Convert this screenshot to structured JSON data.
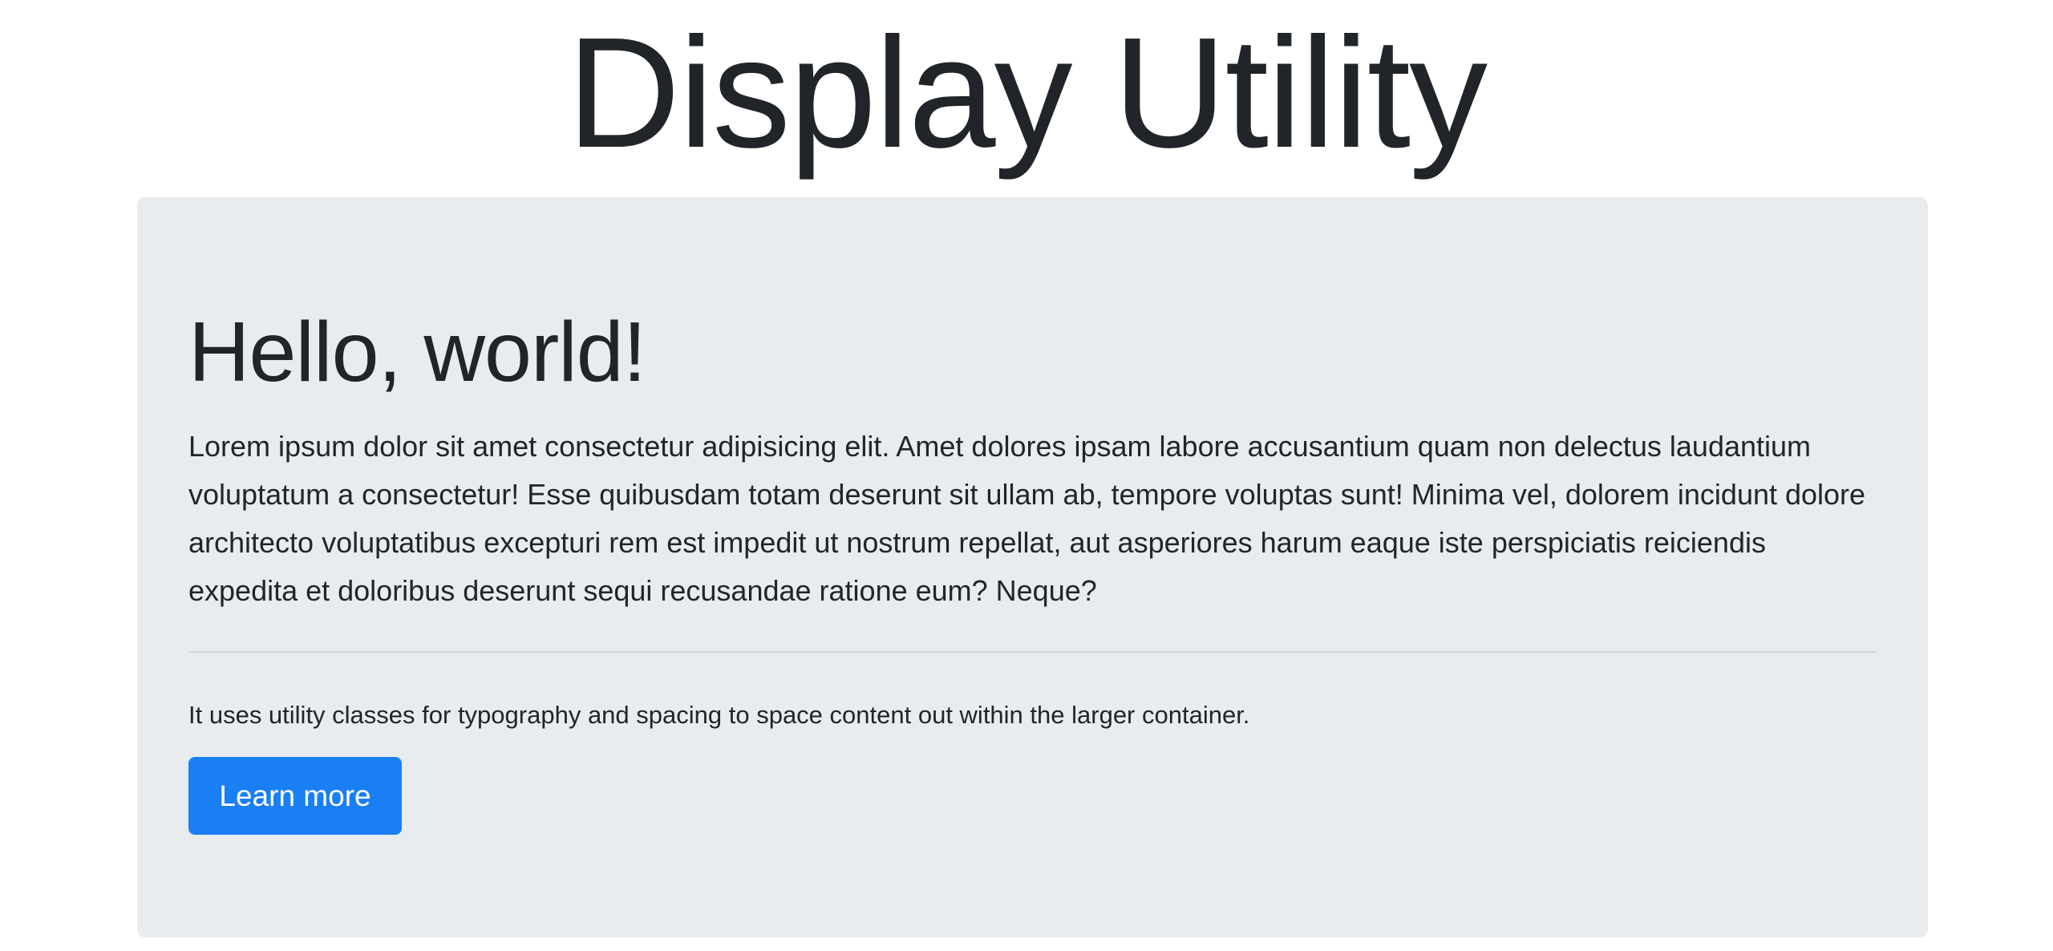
{
  "page": {
    "title": "Display Utility"
  },
  "jumbotron": {
    "heading": "Hello, world!",
    "lead": "Lorem ipsum dolor sit amet consectetur adipisicing elit. Amet dolores ipsam labore accusantium quam non delectus laudantium voluptatum a consectetur! Esse quibusdam totam deserunt sit ullam ab, tempore voluptas sunt! Minima vel, dolorem incidunt dolore architecto voluptatibus excepturi rem est impedit ut nostrum repellat, aut asperiores harum eaque iste perspiciatis reiciendis expedita et doloribus deserunt sequi recusandae ratione eum? Neque?",
    "info": "It uses utility classes for typography and spacing to space content out within the larger container.",
    "button_label": "Learn more"
  },
  "colors": {
    "text": "#212529",
    "jumbotron_bg": "#e9ecef",
    "primary": "#1a7ff5",
    "divider": "#cfd3d7"
  }
}
